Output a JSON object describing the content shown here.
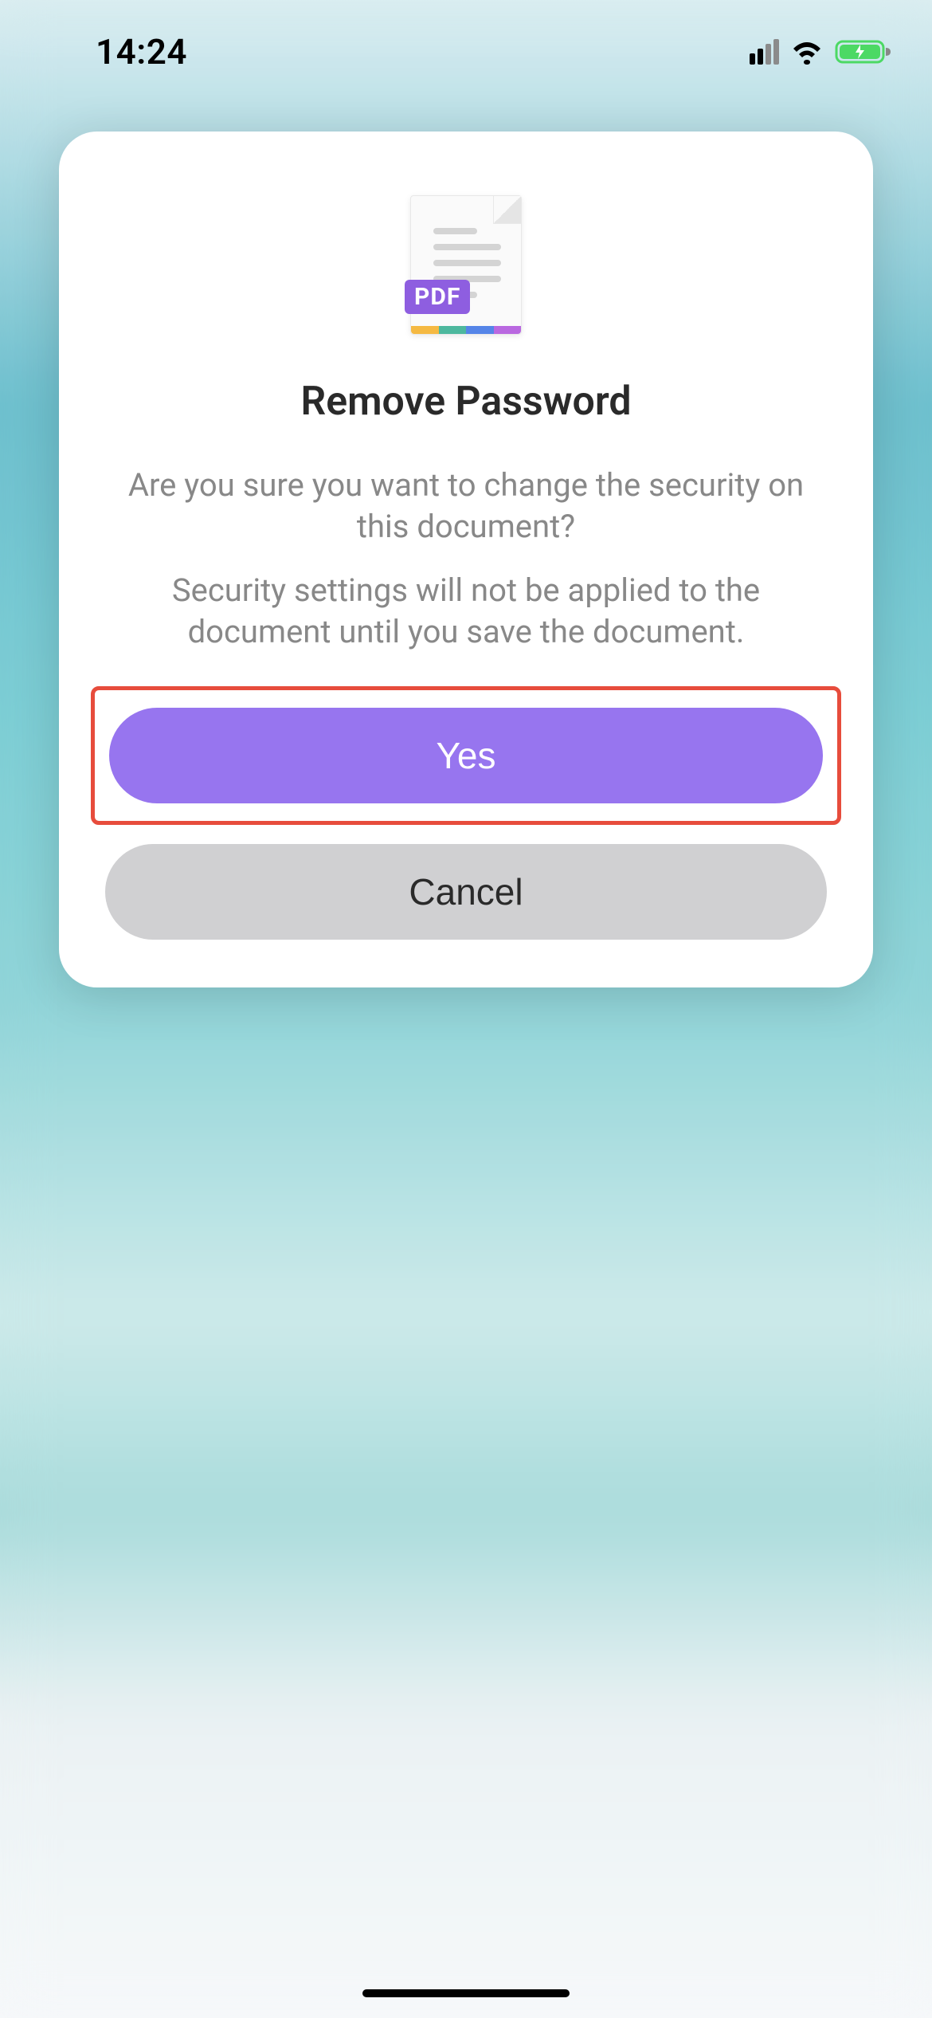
{
  "status": {
    "time": "14:24"
  },
  "dialog": {
    "pdf_badge": "PDF",
    "title": "Remove Password",
    "message": "Are you sure you want to change the security on this document?",
    "submessage": "Security settings will not be applied to the document until you save the document.",
    "yes_label": "Yes",
    "cancel_label": "Cancel"
  }
}
